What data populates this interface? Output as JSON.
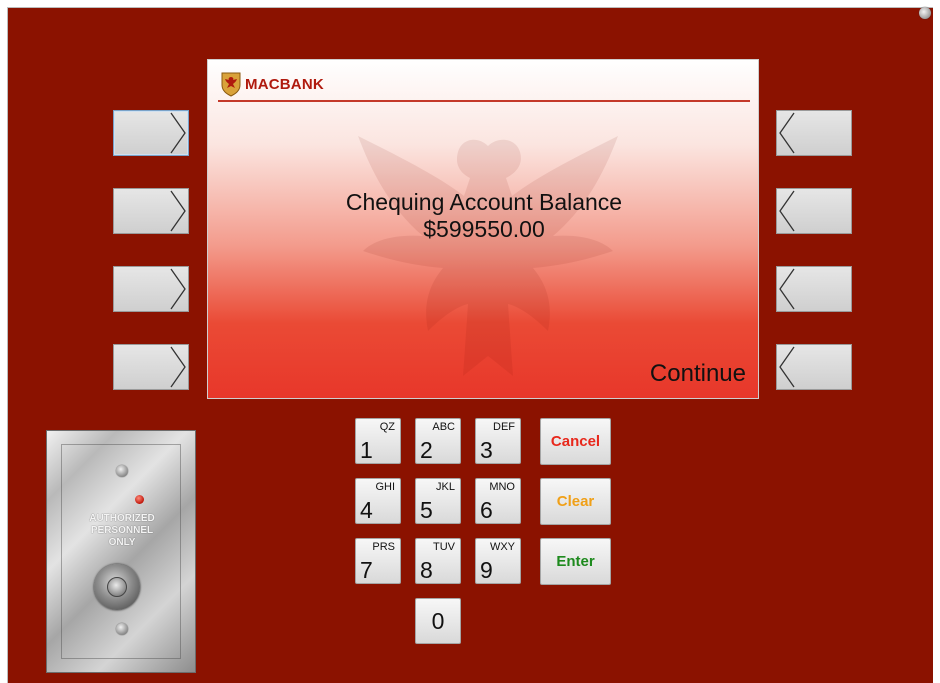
{
  "brand": {
    "name": "MACBANK"
  },
  "screen": {
    "title": "Chequing Account Balance",
    "amount": "$599550.00",
    "continue_label": "Continue"
  },
  "keypad": {
    "keys": [
      {
        "digit": "1",
        "letters": "QZ"
      },
      {
        "digit": "2",
        "letters": "ABC"
      },
      {
        "digit": "3",
        "letters": "DEF"
      },
      {
        "digit": "4",
        "letters": "GHI"
      },
      {
        "digit": "5",
        "letters": "JKL"
      },
      {
        "digit": "6",
        "letters": "MNO"
      },
      {
        "digit": "7",
        "letters": "PRS"
      },
      {
        "digit": "8",
        "letters": "TUV"
      },
      {
        "digit": "9",
        "letters": "WXY"
      },
      {
        "digit": "0",
        "letters": ""
      }
    ],
    "cancel_label": "Cancel",
    "clear_label": "Clear",
    "enter_label": "Enter"
  },
  "key_plate": {
    "line1": "AUTHORIZED",
    "line2": "PERSONNEL",
    "line3": "ONLY"
  },
  "colors": {
    "panel": "#8b1200",
    "brand_red": "#b01a0e",
    "cancel": "#e8281c",
    "clear": "#f0a018",
    "enter": "#1e8a1e"
  },
  "icons": {
    "left_buttons": "chevron-right-icon",
    "right_buttons": "chevron-left-icon",
    "brand_logo": "eagle-shield-icon"
  }
}
